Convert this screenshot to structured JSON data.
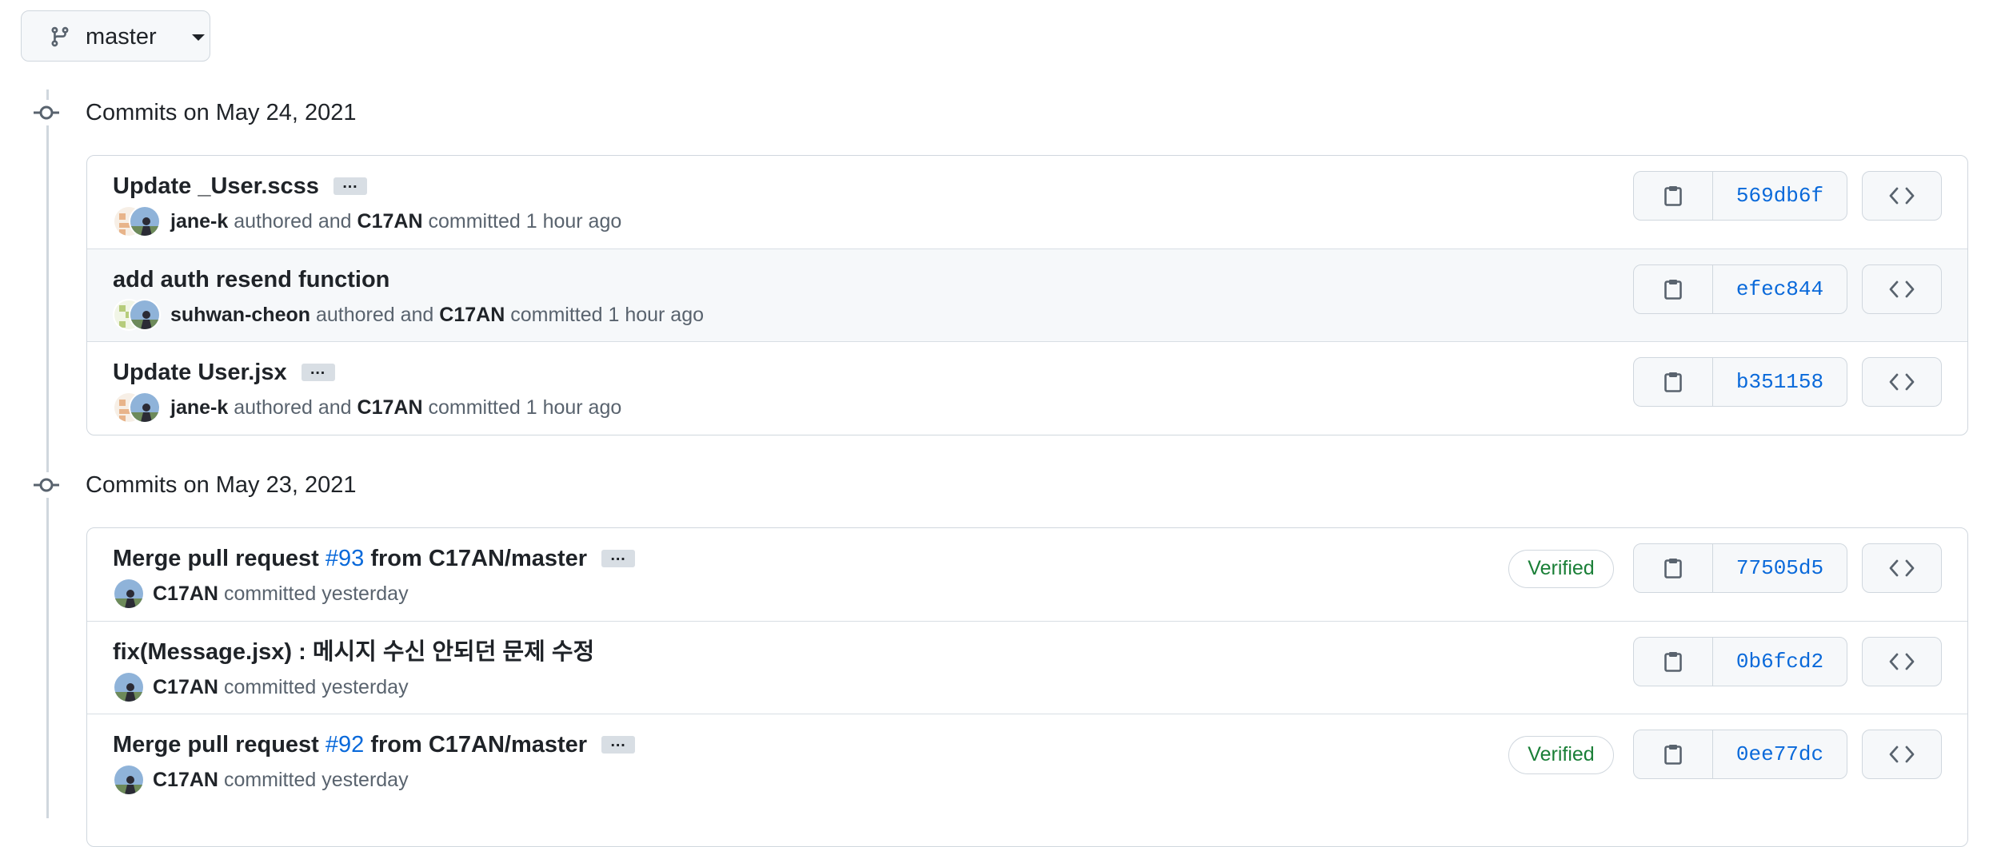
{
  "branch": {
    "name": "master",
    "icon": "git-branch-icon"
  },
  "groups": [
    {
      "title": "Commits on May 24, 2021",
      "commits": [
        {
          "message": "Update _User.scss",
          "has_ellipsis": true,
          "author": "jane-k",
          "authored_text": "authored and",
          "committer": "C17AN",
          "committed_text": "committed 1 hour ago",
          "sha": "569db6f",
          "verified": false
        },
        {
          "message": "add auth resend function",
          "has_ellipsis": false,
          "author": "suhwan-cheon",
          "authored_text": "authored and",
          "committer": "C17AN",
          "committed_text": "committed 1 hour ago",
          "sha": "efec844",
          "verified": false
        },
        {
          "message": "Update User.jsx",
          "has_ellipsis": true,
          "author": "jane-k",
          "authored_text": "authored and",
          "committer": "C17AN",
          "committed_text": "committed 1 hour ago",
          "sha": "b351158",
          "verified": false
        }
      ]
    },
    {
      "title": "Commits on May 23, 2021",
      "commits": [
        {
          "message_prefix": "Merge pull request ",
          "pr_link": "#93",
          "message_suffix": " from C17AN/master",
          "has_ellipsis": true,
          "committer": "C17AN",
          "committed_text": "committed yesterday",
          "verified_label": "Verified",
          "sha": "77505d5"
        },
        {
          "message": "fix(Message.jsx) : 메시지 수신 안되던 문제 수정",
          "has_ellipsis": false,
          "committer": "C17AN",
          "committed_text": "committed yesterday",
          "sha": "0b6fcd2"
        },
        {
          "message_prefix": "Merge pull request ",
          "pr_link": "#92",
          "message_suffix": " from C17AN/master",
          "has_ellipsis": true,
          "committer": "C17AN",
          "committed_text": "committed yesterday",
          "verified_label": "Verified",
          "sha": "0ee77dc"
        }
      ]
    }
  ],
  "ellipsis_label": "…",
  "icons": {
    "copy": "clipboard-icon",
    "browse": "code-icon",
    "commit": "git-commit-icon"
  },
  "colors": {
    "link": "#0969da",
    "verified": "#1a7f37",
    "border": "#d0d7de"
  }
}
